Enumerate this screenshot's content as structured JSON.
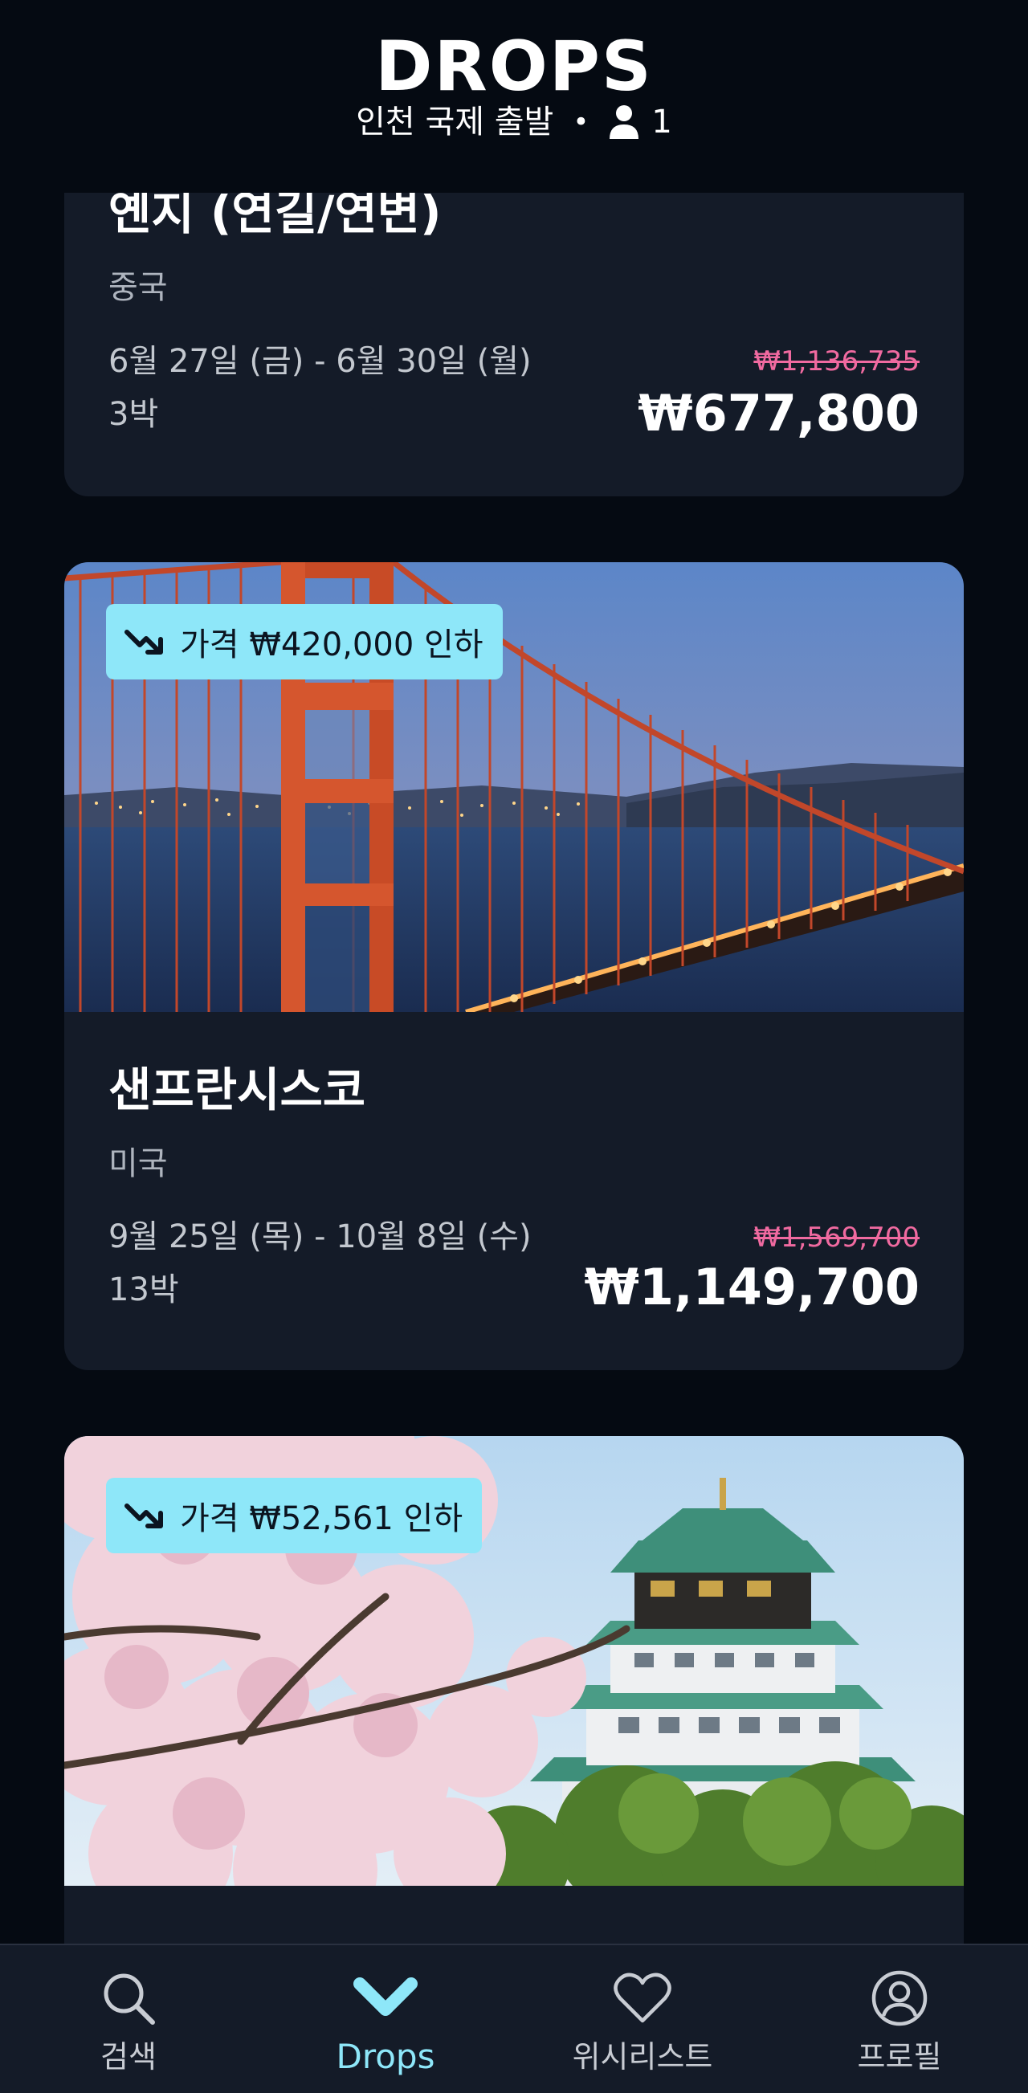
{
  "header": {
    "logo": "DROPS",
    "origin": "인천 국제 출발",
    "separator": "•",
    "travelers": "1"
  },
  "cards": [
    {
      "title": "옌지 (연길/연변)",
      "country": "중국",
      "dates": "6월 27일 (금) - 6월 30일 (월)",
      "nights": "3박",
      "old_price": "₩1,136,735",
      "new_price": "₩677,800"
    },
    {
      "badge": "가격 ₩420,000 인하",
      "title": "샌프란시스코",
      "country": "미국",
      "dates": "9월 25일 (목) - 10월 8일 (수)",
      "nights": "13박",
      "old_price": "₩1,569,700",
      "new_price": "₩1,149,700"
    },
    {
      "badge": "가격 ₩52,561 인하"
    }
  ],
  "bottom_nav": {
    "items": [
      {
        "label": "검색",
        "icon": "search-icon"
      },
      {
        "label": "Drops",
        "icon": "chevron-down-icon",
        "active": true
      },
      {
        "label": "위시리스트",
        "icon": "heart-icon"
      },
      {
        "label": "프로필",
        "icon": "profile-icon"
      }
    ]
  },
  "colors": {
    "background": "#050a12",
    "card": "#141b28",
    "accent": "#8ee7f9",
    "old_price": "#f06aa0"
  }
}
